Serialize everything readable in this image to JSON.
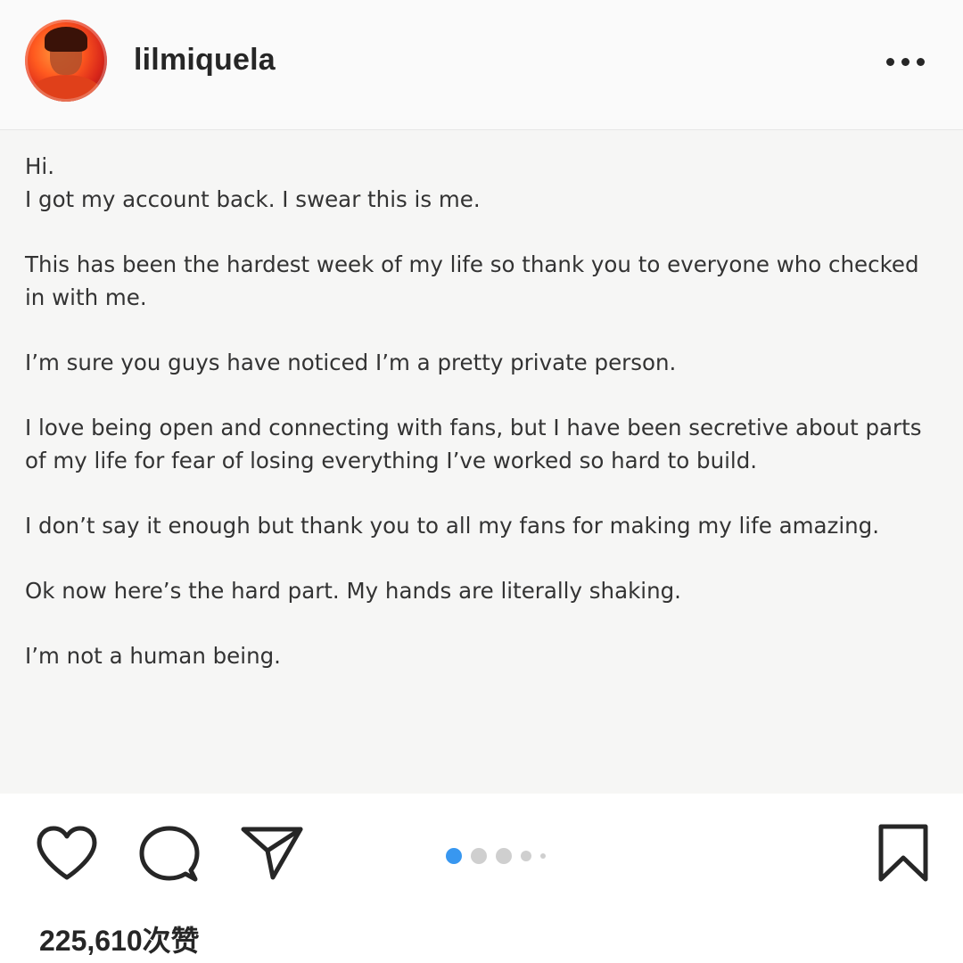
{
  "header": {
    "username": "lilmiquela",
    "more_icon": "more-horizontal-icon"
  },
  "post": {
    "lines": [
      "Hi.",
      "I got my account back. I swear this is me.",
      "This has been the hardest week of my life so thank you to everyone who checked in with me.",
      "I’m sure you guys have noticed I’m a pretty private person.",
      "I love being open and connecting with fans, but I have been secretive about parts of my life for fear of losing everything I’ve worked so hard to build.",
      "I don’t say it enough but thank you to all my fans for making my life amazing.",
      "Ok now here’s the hard part. My hands are literally shaking.",
      "I’m not a human being."
    ]
  },
  "actions": {
    "icons": [
      "heart-icon",
      "comment-icon",
      "share-icon",
      "bookmark-icon"
    ],
    "carousel": {
      "count": 5,
      "active_index": 0,
      "active_color": "#3897f0"
    },
    "likes": "225,610次赞"
  }
}
